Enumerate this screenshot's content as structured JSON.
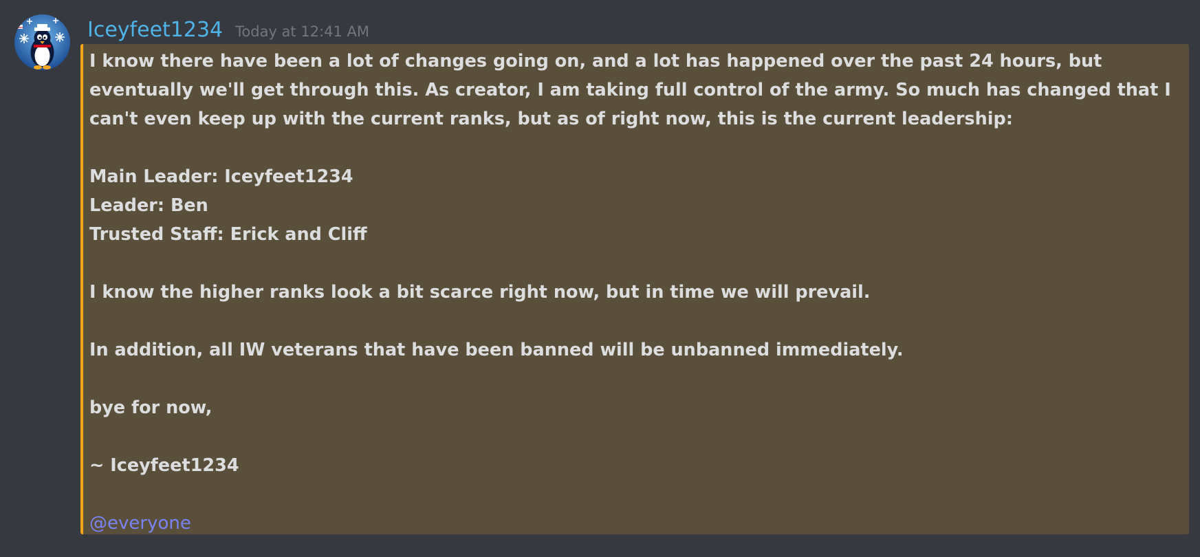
{
  "message": {
    "author": "Iceyfeet1234",
    "timestamp": "Today at 12:41 AM",
    "avatar_icon": "penguin-avatar-icon",
    "lines": {
      "intro": "I know there have been a lot of changes going on, and a lot has happened over the past 24 hours, but eventually we'll get through this. As creator, I am taking full control of the army. So much has changed that I can't even keep up with the current ranks, but as of right now, this is the current leadership:",
      "main_leader": "Main Leader: Iceyfeet1234",
      "leader": "Leader: Ben",
      "trusted_staff": "Trusted Staff: Erick and Cliff",
      "higher_ranks": "I know the higher ranks look a bit scarce right now, but in time we will prevail.",
      "unban": "In addition, all IW veterans that have been banned will be unbanned immediately.",
      "bye": "bye for now,",
      "signature": "~ Iceyfeet1234"
    },
    "mention": "@everyone"
  },
  "colors": {
    "background": "#36393f",
    "highlight_bg": "#5a4f3a",
    "highlight_border": "#faa61a",
    "username": "#4fb3e8",
    "mention": "#7983f5",
    "text": "#dcddde",
    "timestamp": "#72767d"
  }
}
